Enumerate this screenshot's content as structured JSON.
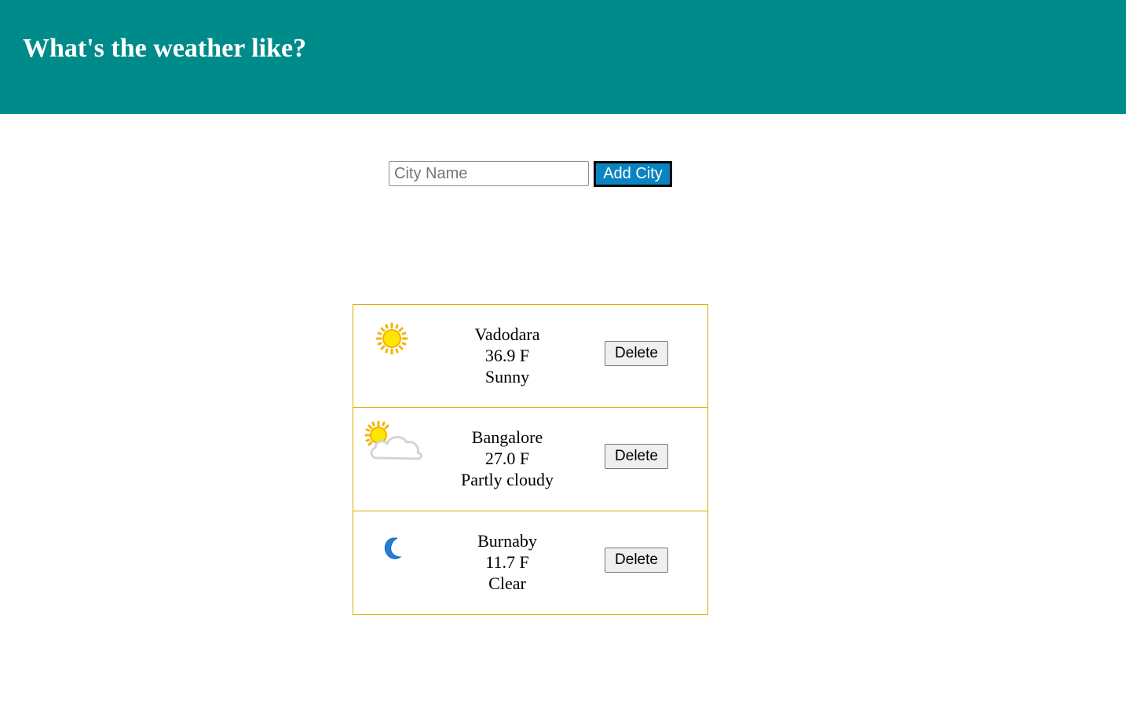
{
  "header": {
    "title": "What's the weather like?",
    "background_color": "#008b8b"
  },
  "form": {
    "city_input_placeholder": "City Name",
    "city_input_value": "",
    "add_button_label": "Add City",
    "add_button_color": "#0a84c0"
  },
  "cities": [
    {
      "name": "Vadodara",
      "temperature": "36.9 F",
      "condition": "Sunny",
      "icon": "sun-icon",
      "delete_label": "Delete"
    },
    {
      "name": "Bangalore",
      "temperature": "27.0 F",
      "condition": "Partly cloudy",
      "icon": "partly-cloudy-icon",
      "delete_label": "Delete"
    },
    {
      "name": "Burnaby",
      "temperature": "11.7 F",
      "condition": "Clear",
      "icon": "moon-icon",
      "delete_label": "Delete"
    }
  ],
  "card_border_color": "#e0a800"
}
